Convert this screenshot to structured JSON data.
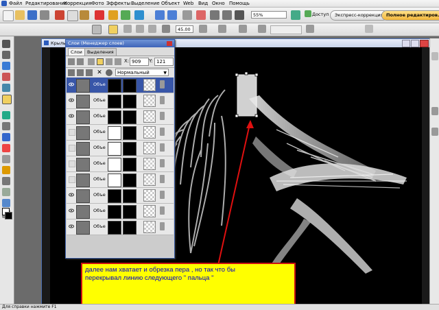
{
  "menubar": {
    "items": [
      "Файл",
      "Редактирование",
      "Коррекция",
      "Фото",
      "Эффекты",
      "Выделение",
      "Объект",
      "Web",
      "Вид",
      "Окно",
      "Помощь"
    ]
  },
  "toolbar1": {
    "zoom": "55%",
    "access_label": "Доступ",
    "express_label": "Экспресс-коррекция",
    "full_edit_label": "Полное редактиров..."
  },
  "toolbar2": {
    "angle": "45.00"
  },
  "document": {
    "tab_title": "Крыль"
  },
  "layers_panel": {
    "title": "Слои (Менеджер слоев)",
    "tabs": [
      "Слои",
      "Выделения"
    ],
    "x_label": "X:",
    "x_value": "909",
    "y_label": "Y:",
    "y_value": "121",
    "blend_mode": "Нормальный",
    "layers": [
      {
        "name": "Объе",
        "visible": true,
        "selected": true
      },
      {
        "name": "Объе",
        "visible": true,
        "selected": false
      },
      {
        "name": "Объе",
        "visible": true,
        "selected": false
      },
      {
        "name": "Объе",
        "visible": false,
        "selected": false
      },
      {
        "name": "Объе",
        "visible": false,
        "selected": false
      },
      {
        "name": "Объе",
        "visible": false,
        "selected": false
      },
      {
        "name": "Объе",
        "visible": false,
        "selected": false
      },
      {
        "name": "Объе",
        "visible": true,
        "selected": false
      },
      {
        "name": "Объе",
        "visible": true,
        "selected": false
      },
      {
        "name": "Объе",
        "visible": true,
        "selected": false
      }
    ]
  },
  "callout": {
    "line1": "далее нам хватает и обрезка пера , но так что бы",
    "line2": "перекрывал линию следующего  \" пальца \""
  },
  "status": {
    "text": "Для справки нажмите F1"
  },
  "colors": {
    "accent": "#3856a8",
    "callout_bg": "#ffff00",
    "callout_border": "#cc1111",
    "callout_text": "#0000cc",
    "arrow": "#e01010"
  }
}
